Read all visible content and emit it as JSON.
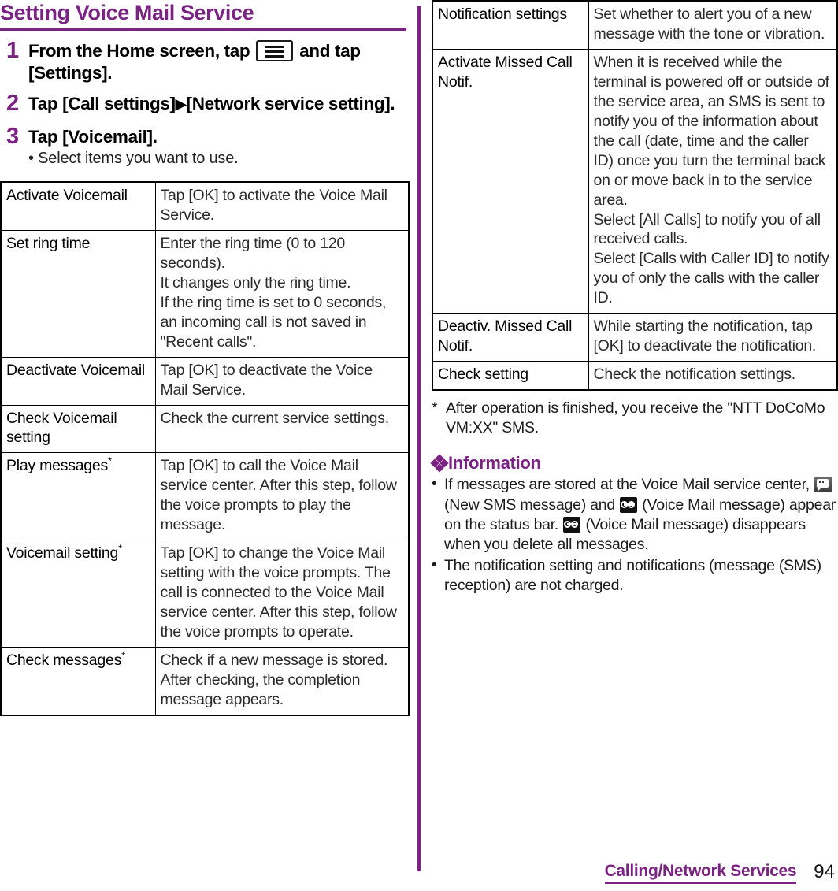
{
  "section": {
    "title": "Setting Voice Mail Service"
  },
  "steps": [
    {
      "number": "1",
      "text_before": "From the Home screen, tap",
      "icon": "menu-key-icon",
      "text_after": "and tap [Settings]."
    },
    {
      "number": "2",
      "text_before": "Tap [Call settings]",
      "icon": "right-triangle-icon",
      "text_after": "[Network service setting]."
    },
    {
      "number": "3",
      "text_before": "Tap [Voicemail].",
      "icon": "",
      "text_after": "",
      "sub": "• Select items you want to use."
    }
  ],
  "left_table": {
    "rows": [
      {
        "key": "Activate Voicemail",
        "key_star": false,
        "value": "Tap [OK] to activate the Voice Mail Service."
      },
      {
        "key": "Set ring time",
        "key_star": false,
        "value": "Enter the ring time (0 to 120 seconds).\nIt changes only the ring time.\nIf the ring time is set to 0 seconds, an incoming call is not saved in \"Recent calls\"."
      },
      {
        "key": "Deactivate Voicemail",
        "key_star": false,
        "value": "Tap [OK] to deactivate the Voice Mail Service."
      },
      {
        "key": "Check Voicemail setting",
        "key_star": false,
        "value": "Check the current service settings."
      },
      {
        "key": "Play messages",
        "key_star": true,
        "value": "Tap [OK] to call the Voice Mail service center. After this step, follow the voice prompts to play the message."
      },
      {
        "key": "Voicemail setting",
        "key_star": true,
        "value": "Tap [OK] to change the Voice Mail setting with the voice prompts. The call is connected to the Voice Mail service center. After this step, follow the voice prompts to operate."
      },
      {
        "key": "Check messages",
        "key_star": true,
        "value": "Check if a new message is stored. After checking, the completion message appears."
      }
    ]
  },
  "right_table": {
    "rows": [
      {
        "key": "Notification settings",
        "key_star": false,
        "value": "Set whether to alert you of a new message with the tone or vibration."
      },
      {
        "key": "Activate Missed Call Notif.",
        "key_star": false,
        "value": "When it is received while the terminal is powered off or outside of the service area, an SMS is sent to notify you of the information about the call (date, time and the caller ID) once you turn the terminal back on or move back in to the service area.\nSelect [All Calls] to notify you of all received calls.\nSelect [Calls with Caller ID] to notify you of only the calls with the caller ID."
      },
      {
        "key": "Deactiv. Missed Call Notif.",
        "key_star": false,
        "value": "While starting the notification, tap [OK] to deactivate the notification."
      },
      {
        "key": "Check setting",
        "key_star": false,
        "value": "Check the notification settings."
      }
    ]
  },
  "footnote": {
    "mark": "*",
    "text": "After operation is finished, you receive the \"NTT DoCoMo VM:XX\" SMS."
  },
  "information": {
    "heading": "Information",
    "heading_icon": "diamond-cluster-icon",
    "bullets": [
      {
        "dot": "•",
        "part1": "If messages are stored at the Voice Mail service center,",
        "icon1": "new-sms-message-icon",
        "part2": "(New SMS message) and",
        "icon2": "voice-mail-message-icon",
        "part3": "(Voice Mail message) appear on the status bar.",
        "icon3": "voice-mail-message-icon",
        "part4": "(Voice Mail message) disappears when you delete all messages."
      },
      {
        "dot": "•",
        "part1": "The notification setting and notifications (message (SMS) reception) are not charged."
      }
    ]
  },
  "footer": {
    "title": "Calling/Network Services",
    "page": "94"
  },
  "colors": {
    "accent_purple": "#7B2382",
    "text_black": "#1b1b1b"
  }
}
